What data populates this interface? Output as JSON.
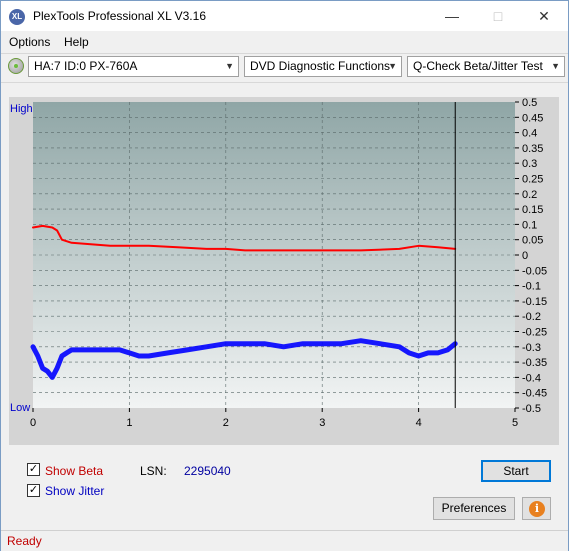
{
  "app": {
    "icon_text": "XL",
    "title": "PlexTools Professional XL V3.16"
  },
  "menu": {
    "options": "Options",
    "help": "Help"
  },
  "toolbar": {
    "drive": "HA:7 ID:0  PX-760A",
    "function": "DVD Diagnostic Functions",
    "test": "Q-Check Beta/Jitter Test"
  },
  "chart_data": {
    "type": "line",
    "left_axis": {
      "top_label": "High",
      "bottom_label": "Low"
    },
    "right_axis": {
      "ylim": [
        -0.5,
        0.5
      ],
      "ticks": [
        "0.5",
        "0.45",
        "0.4",
        "0.35",
        "0.3",
        "0.25",
        "0.2",
        "0.15",
        "0.1",
        "0.05",
        "0",
        "-0.05",
        "-0.1",
        "-0.15",
        "-0.2",
        "-0.25",
        "-0.3",
        "-0.35",
        "-0.4",
        "-0.45",
        "-0.5"
      ]
    },
    "x_axis": {
      "xlim": [
        0,
        5
      ],
      "ticks": [
        "0",
        "1",
        "2",
        "3",
        "4",
        "5"
      ]
    },
    "end_marker_x": 4.38,
    "grid": true,
    "series": [
      {
        "color": "#ff0000",
        "x": [
          0,
          0.1,
          0.2,
          0.25,
          0.3,
          0.4,
          0.6,
          0.8,
          1.0,
          1.2,
          1.5,
          1.8,
          2.0,
          2.2,
          2.4,
          2.6,
          3.0,
          3.4,
          3.8,
          4.0,
          4.2,
          4.38
        ],
        "y": [
          0.09,
          0.095,
          0.09,
          0.08,
          0.05,
          0.04,
          0.035,
          0.03,
          0.03,
          0.03,
          0.025,
          0.02,
          0.02,
          0.015,
          0.015,
          0.015,
          0.015,
          0.015,
          0.02,
          0.03,
          0.025,
          0.02
        ]
      },
      {
        "color": "#0000ff",
        "x": [
          0,
          0.05,
          0.1,
          0.15,
          0.2,
          0.25,
          0.3,
          0.35,
          0.4,
          0.5,
          0.7,
          0.9,
          1.0,
          1.1,
          1.2,
          1.4,
          1.6,
          1.8,
          2.0,
          2.2,
          2.4,
          2.6,
          2.8,
          3.0,
          3.2,
          3.4,
          3.6,
          3.8,
          3.9,
          4.0,
          4.1,
          4.2,
          4.3,
          4.38
        ],
        "y": [
          -0.3,
          -0.33,
          -0.37,
          -0.38,
          -0.4,
          -0.37,
          -0.33,
          -0.32,
          -0.31,
          -0.31,
          -0.31,
          -0.31,
          -0.32,
          -0.33,
          -0.33,
          -0.32,
          -0.31,
          -0.3,
          -0.29,
          -0.29,
          -0.29,
          -0.3,
          -0.29,
          -0.29,
          -0.29,
          -0.28,
          -0.29,
          -0.3,
          -0.32,
          -0.33,
          -0.32,
          -0.32,
          -0.31,
          -0.29
        ]
      }
    ]
  },
  "options": {
    "show_beta": {
      "label": "Show Beta",
      "checked": true,
      "color": "#c00000"
    },
    "show_jitter": {
      "label": "Show Jitter",
      "checked": true,
      "color": "#0000c0"
    }
  },
  "lsn": {
    "label": "LSN:",
    "value": "2295040"
  },
  "buttons": {
    "start": "Start",
    "preferences": "Preferences"
  },
  "status": {
    "text": "Ready"
  }
}
